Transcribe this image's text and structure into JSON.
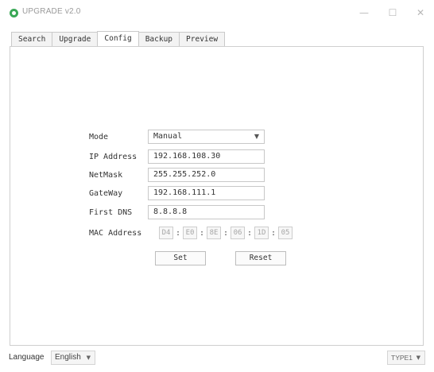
{
  "window": {
    "title": "UPGRADE v2.0",
    "controls": {
      "minimize": "—",
      "maximize": "☐",
      "close": "✕"
    }
  },
  "tabs": [
    {
      "label": "Search",
      "active": false
    },
    {
      "label": "Upgrade",
      "active": false
    },
    {
      "label": "Config",
      "active": true
    },
    {
      "label": "Backup",
      "active": false
    },
    {
      "label": "Preview",
      "active": false
    }
  ],
  "config": {
    "mode": {
      "label": "Mode",
      "value": "Manual"
    },
    "ip": {
      "label": "IP Address",
      "value": "192.168.108.30"
    },
    "netmask": {
      "label": "NetMask",
      "value": "255.255.252.0"
    },
    "gateway": {
      "label": "GateWay",
      "value": "192.168.111.1"
    },
    "dns": {
      "label": "First DNS",
      "value": "8.8.8.8"
    },
    "mac": {
      "label": "MAC Address",
      "octets": [
        "D4",
        "E0",
        "8E",
        "06",
        "1D",
        "05"
      ],
      "separator": ":"
    },
    "buttons": {
      "set": "Set",
      "reset": "Reset"
    }
  },
  "footer": {
    "language_label": "Language",
    "language_value": "English",
    "type_value": "TYPE1"
  },
  "icons": {
    "app": "app-logo-icon",
    "dropdown": "chevron-down-icon"
  },
  "colors": {
    "app_icon": "#3aa856",
    "border": "#c8c8c8"
  }
}
